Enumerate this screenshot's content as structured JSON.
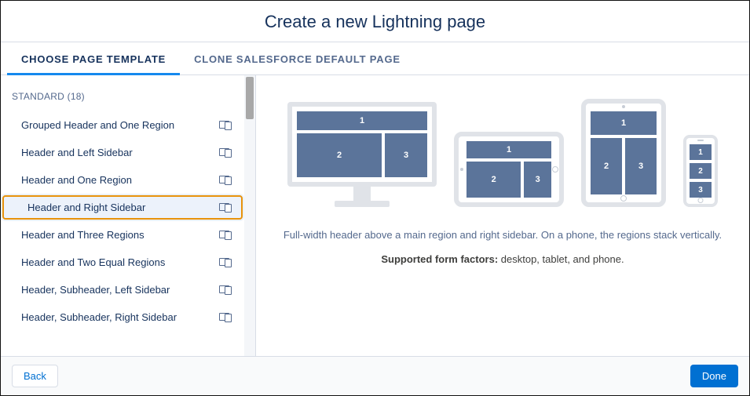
{
  "header": {
    "title": "Create a new Lightning page"
  },
  "tabs": [
    {
      "label": "CHOOSE PAGE TEMPLATE",
      "active": true
    },
    {
      "label": "CLONE SALESFORCE DEFAULT PAGE",
      "active": false
    }
  ],
  "sidebar": {
    "group_label": "STANDARD (18)",
    "templates": [
      {
        "label": "Grouped Header and One Region",
        "selected": false
      },
      {
        "label": "Header and Left Sidebar",
        "selected": false
      },
      {
        "label": "Header and One Region",
        "selected": false
      },
      {
        "label": "Header and Right Sidebar",
        "selected": true
      },
      {
        "label": "Header and Three Regions",
        "selected": false
      },
      {
        "label": "Header and Two Equal Regions",
        "selected": false
      },
      {
        "label": "Header, Subheader, Left Sidebar",
        "selected": false
      },
      {
        "label": "Header, Subheader, Right Sidebar",
        "selected": false
      }
    ]
  },
  "preview": {
    "region_labels": {
      "r1": "1",
      "r2": "2",
      "r3": "3"
    },
    "description": "Full-width header above a main region and right sidebar. On a phone, the regions stack vertically.",
    "form_factors_label": "Supported form factors:",
    "form_factors_value": " desktop, tablet, and phone."
  },
  "footer": {
    "back": "Back",
    "done": "Done"
  }
}
